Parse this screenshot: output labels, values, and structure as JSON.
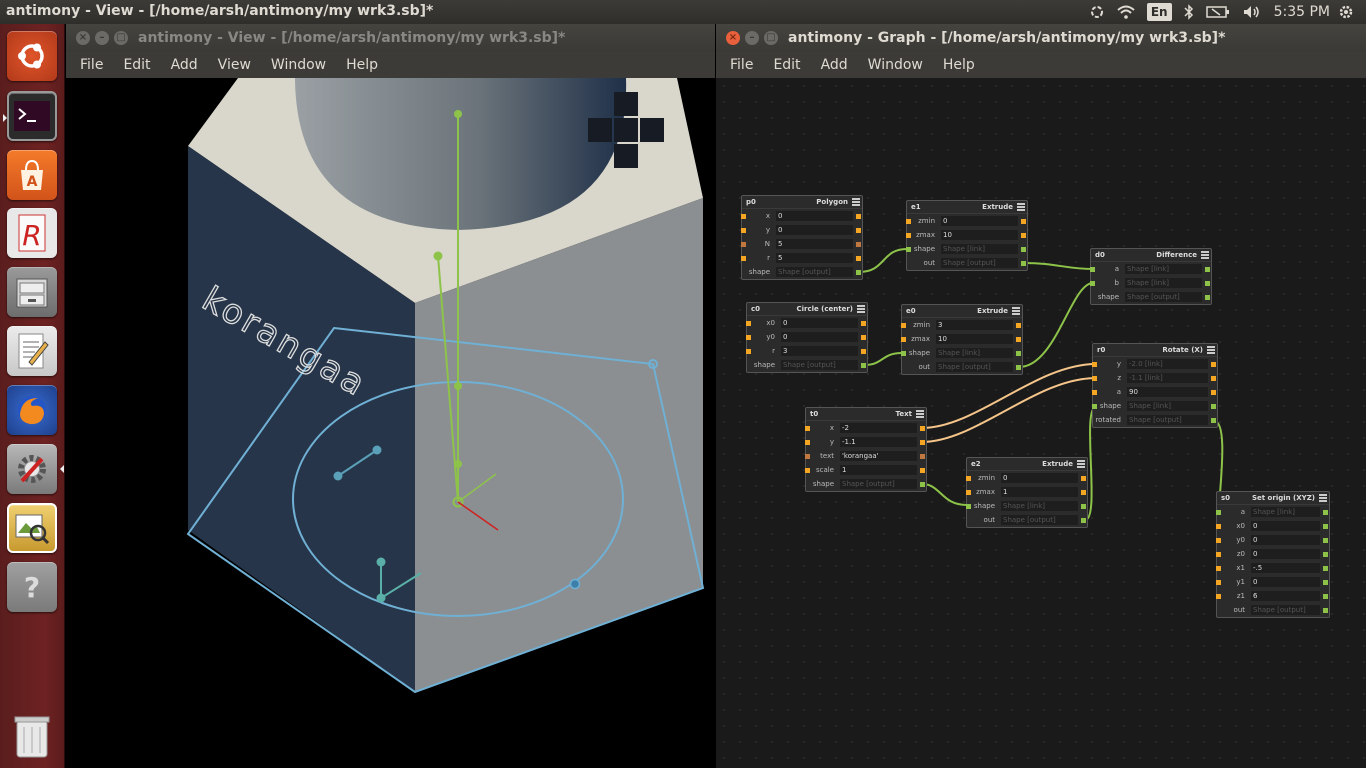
{
  "topbar": {
    "title": "antimony - View - [/home/arsh/antimony/my wrk3.sb]*",
    "lang": "En",
    "clock": "5:35 PM"
  },
  "launcher": {
    "items": [
      "ubuntu-dash",
      "terminal",
      "software-center",
      "rstudio",
      "files",
      "text-editor",
      "firefox",
      "system-settings",
      "image-viewer",
      "help",
      "trash"
    ]
  },
  "view_window": {
    "title": "antimony - View - [/home/arsh/antimony/my wrk3.sb]*",
    "menu": [
      "File",
      "Edit",
      "Add",
      "View",
      "Window",
      "Help"
    ],
    "scene_text": "korangaa"
  },
  "graph_window": {
    "title": "antimony - Graph - [/home/arsh/antimony/my wrk3.sb]*",
    "menu": [
      "File",
      "Edit",
      "Add",
      "Window",
      "Help"
    ]
  },
  "nodes": {
    "p0": {
      "id": "p0",
      "type": "Polygon",
      "rows": [
        [
          "x",
          "0"
        ],
        [
          "y",
          "0"
        ],
        [
          "N",
          "5"
        ],
        [
          "r",
          "5"
        ],
        [
          "shape",
          "Shape [output]"
        ]
      ]
    },
    "e1": {
      "id": "e1",
      "type": "Extrude",
      "rows": [
        [
          "zmin",
          "0"
        ],
        [
          "zmax",
          "10"
        ],
        [
          "shape",
          "Shape [link]"
        ],
        [
          "out",
          "Shape [output]"
        ]
      ]
    },
    "d0": {
      "id": "d0",
      "type": "Difference",
      "rows": [
        [
          "a",
          "Shape [link]"
        ],
        [
          "b",
          "Shape [link]"
        ],
        [
          "shape",
          "Shape [output]"
        ]
      ]
    },
    "c0": {
      "id": "c0",
      "type": "Circle (center)",
      "rows": [
        [
          "x0",
          "0"
        ],
        [
          "y0",
          "0"
        ],
        [
          "r",
          "3"
        ],
        [
          "shape",
          "Shape [output]"
        ]
      ]
    },
    "e0": {
      "id": "e0",
      "type": "Extrude",
      "rows": [
        [
          "zmin",
          "3"
        ],
        [
          "zmax",
          "10"
        ],
        [
          "shape",
          "Shape [link]"
        ],
        [
          "out",
          "Shape [output]"
        ]
      ]
    },
    "r0": {
      "id": "r0",
      "type": "Rotate (X)",
      "rows": [
        [
          "y",
          "-2.0 [link]"
        ],
        [
          "z",
          "-1.1 [link]"
        ],
        [
          "a",
          "90"
        ],
        [
          "shape",
          "Shape [link]"
        ],
        [
          "rotated",
          "Shape [output]"
        ]
      ]
    },
    "t0": {
      "id": "t0",
      "type": "Text",
      "rows": [
        [
          "x",
          "-2"
        ],
        [
          "y",
          "-1.1"
        ],
        [
          "text",
          "'korangaa'"
        ],
        [
          "scale",
          "1"
        ],
        [
          "shape",
          "Shape [output]"
        ]
      ]
    },
    "e2": {
      "id": "e2",
      "type": "Extrude",
      "rows": [
        [
          "zmin",
          "0"
        ],
        [
          "zmax",
          "1"
        ],
        [
          "shape",
          "Shape [link]"
        ],
        [
          "out",
          "Shape [output]"
        ]
      ]
    },
    "s0": {
      "id": "s0",
      "type": "Set origin (XYZ)",
      "rows": [
        [
          "a",
          "Shape [link]"
        ],
        [
          "x0",
          "0"
        ],
        [
          "y0",
          "0"
        ],
        [
          "z0",
          "0"
        ],
        [
          "x1",
          "-.5"
        ],
        [
          "y1",
          "0"
        ],
        [
          "z1",
          "6"
        ],
        [
          "out",
          "Shape [output]"
        ]
      ]
    }
  },
  "colors": {
    "port_input": "#f5a623",
    "port_shape": "#8ec34a",
    "wire_green": "#8ec34a",
    "wire_orange": "#f5c58a",
    "outline_blue": "#6fb0d4"
  }
}
